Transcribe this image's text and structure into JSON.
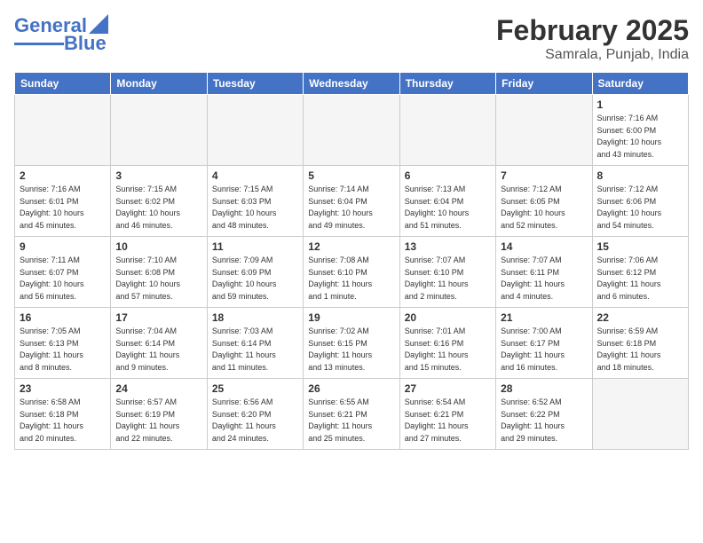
{
  "header": {
    "logo_line1": "General",
    "logo_line2": "Blue",
    "title": "February 2025",
    "subtitle": "Samrala, Punjab, India"
  },
  "weekdays": [
    "Sunday",
    "Monday",
    "Tuesday",
    "Wednesday",
    "Thursday",
    "Friday",
    "Saturday"
  ],
  "weeks": [
    [
      {
        "day": "",
        "info": ""
      },
      {
        "day": "",
        "info": ""
      },
      {
        "day": "",
        "info": ""
      },
      {
        "day": "",
        "info": ""
      },
      {
        "day": "",
        "info": ""
      },
      {
        "day": "",
        "info": ""
      },
      {
        "day": "1",
        "info": "Sunrise: 7:16 AM\nSunset: 6:00 PM\nDaylight: 10 hours\nand 43 minutes."
      }
    ],
    [
      {
        "day": "2",
        "info": "Sunrise: 7:16 AM\nSunset: 6:01 PM\nDaylight: 10 hours\nand 45 minutes."
      },
      {
        "day": "3",
        "info": "Sunrise: 7:15 AM\nSunset: 6:02 PM\nDaylight: 10 hours\nand 46 minutes."
      },
      {
        "day": "4",
        "info": "Sunrise: 7:15 AM\nSunset: 6:03 PM\nDaylight: 10 hours\nand 48 minutes."
      },
      {
        "day": "5",
        "info": "Sunrise: 7:14 AM\nSunset: 6:04 PM\nDaylight: 10 hours\nand 49 minutes."
      },
      {
        "day": "6",
        "info": "Sunrise: 7:13 AM\nSunset: 6:04 PM\nDaylight: 10 hours\nand 51 minutes."
      },
      {
        "day": "7",
        "info": "Sunrise: 7:12 AM\nSunset: 6:05 PM\nDaylight: 10 hours\nand 52 minutes."
      },
      {
        "day": "8",
        "info": "Sunrise: 7:12 AM\nSunset: 6:06 PM\nDaylight: 10 hours\nand 54 minutes."
      }
    ],
    [
      {
        "day": "9",
        "info": "Sunrise: 7:11 AM\nSunset: 6:07 PM\nDaylight: 10 hours\nand 56 minutes."
      },
      {
        "day": "10",
        "info": "Sunrise: 7:10 AM\nSunset: 6:08 PM\nDaylight: 10 hours\nand 57 minutes."
      },
      {
        "day": "11",
        "info": "Sunrise: 7:09 AM\nSunset: 6:09 PM\nDaylight: 10 hours\nand 59 minutes."
      },
      {
        "day": "12",
        "info": "Sunrise: 7:08 AM\nSunset: 6:10 PM\nDaylight: 11 hours\nand 1 minute."
      },
      {
        "day": "13",
        "info": "Sunrise: 7:07 AM\nSunset: 6:10 PM\nDaylight: 11 hours\nand 2 minutes."
      },
      {
        "day": "14",
        "info": "Sunrise: 7:07 AM\nSunset: 6:11 PM\nDaylight: 11 hours\nand 4 minutes."
      },
      {
        "day": "15",
        "info": "Sunrise: 7:06 AM\nSunset: 6:12 PM\nDaylight: 11 hours\nand 6 minutes."
      }
    ],
    [
      {
        "day": "16",
        "info": "Sunrise: 7:05 AM\nSunset: 6:13 PM\nDaylight: 11 hours\nand 8 minutes."
      },
      {
        "day": "17",
        "info": "Sunrise: 7:04 AM\nSunset: 6:14 PM\nDaylight: 11 hours\nand 9 minutes."
      },
      {
        "day": "18",
        "info": "Sunrise: 7:03 AM\nSunset: 6:14 PM\nDaylight: 11 hours\nand 11 minutes."
      },
      {
        "day": "19",
        "info": "Sunrise: 7:02 AM\nSunset: 6:15 PM\nDaylight: 11 hours\nand 13 minutes."
      },
      {
        "day": "20",
        "info": "Sunrise: 7:01 AM\nSunset: 6:16 PM\nDaylight: 11 hours\nand 15 minutes."
      },
      {
        "day": "21",
        "info": "Sunrise: 7:00 AM\nSunset: 6:17 PM\nDaylight: 11 hours\nand 16 minutes."
      },
      {
        "day": "22",
        "info": "Sunrise: 6:59 AM\nSunset: 6:18 PM\nDaylight: 11 hours\nand 18 minutes."
      }
    ],
    [
      {
        "day": "23",
        "info": "Sunrise: 6:58 AM\nSunset: 6:18 PM\nDaylight: 11 hours\nand 20 minutes."
      },
      {
        "day": "24",
        "info": "Sunrise: 6:57 AM\nSunset: 6:19 PM\nDaylight: 11 hours\nand 22 minutes."
      },
      {
        "day": "25",
        "info": "Sunrise: 6:56 AM\nSunset: 6:20 PM\nDaylight: 11 hours\nand 24 minutes."
      },
      {
        "day": "26",
        "info": "Sunrise: 6:55 AM\nSunset: 6:21 PM\nDaylight: 11 hours\nand 25 minutes."
      },
      {
        "day": "27",
        "info": "Sunrise: 6:54 AM\nSunset: 6:21 PM\nDaylight: 11 hours\nand 27 minutes."
      },
      {
        "day": "28",
        "info": "Sunrise: 6:52 AM\nSunset: 6:22 PM\nDaylight: 11 hours\nand 29 minutes."
      },
      {
        "day": "",
        "info": ""
      }
    ]
  ]
}
